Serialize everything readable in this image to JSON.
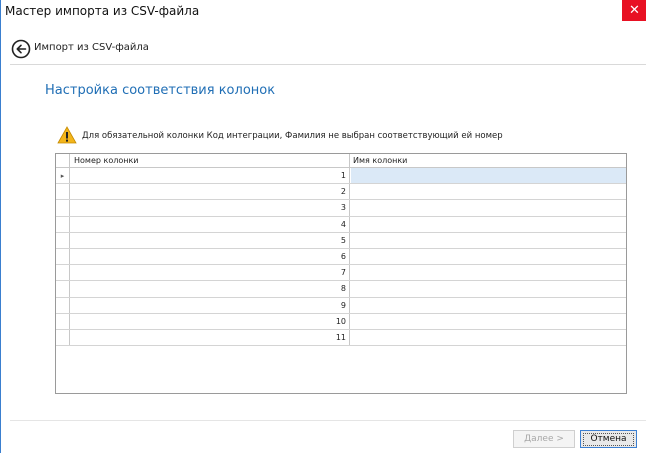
{
  "window": {
    "title": "Мастер импорта из CSV-файла",
    "close_glyph": "✕"
  },
  "nav": {
    "back_icon": "back-arrow-icon",
    "label": "Импорт из CSV-файла"
  },
  "section": {
    "heading": "Настройка соответствия колонок"
  },
  "warning": {
    "icon": "warning-icon",
    "text": "Для обязательной колонки Код интеграции, Фамилия не выбран соответствующий ей номер"
  },
  "grid": {
    "columns": [
      "Номер колонки",
      "Имя колонки"
    ],
    "current_row_marker": "▸",
    "rows": [
      {
        "number": "1",
        "name": ""
      },
      {
        "number": "2",
        "name": ""
      },
      {
        "number": "3",
        "name": ""
      },
      {
        "number": "4",
        "name": ""
      },
      {
        "number": "5",
        "name": ""
      },
      {
        "number": "6",
        "name": ""
      },
      {
        "number": "7",
        "name": ""
      },
      {
        "number": "8",
        "name": ""
      },
      {
        "number": "9",
        "name": ""
      },
      {
        "number": "10",
        "name": ""
      },
      {
        "number": "11",
        "name": ""
      }
    ]
  },
  "buttons": {
    "next": "Далее >",
    "cancel": "Отмена"
  },
  "colors": {
    "heading": "#1f6eb5",
    "close": "#e81123",
    "selection": "#dbe9f7",
    "warning": "#f3b51b"
  }
}
